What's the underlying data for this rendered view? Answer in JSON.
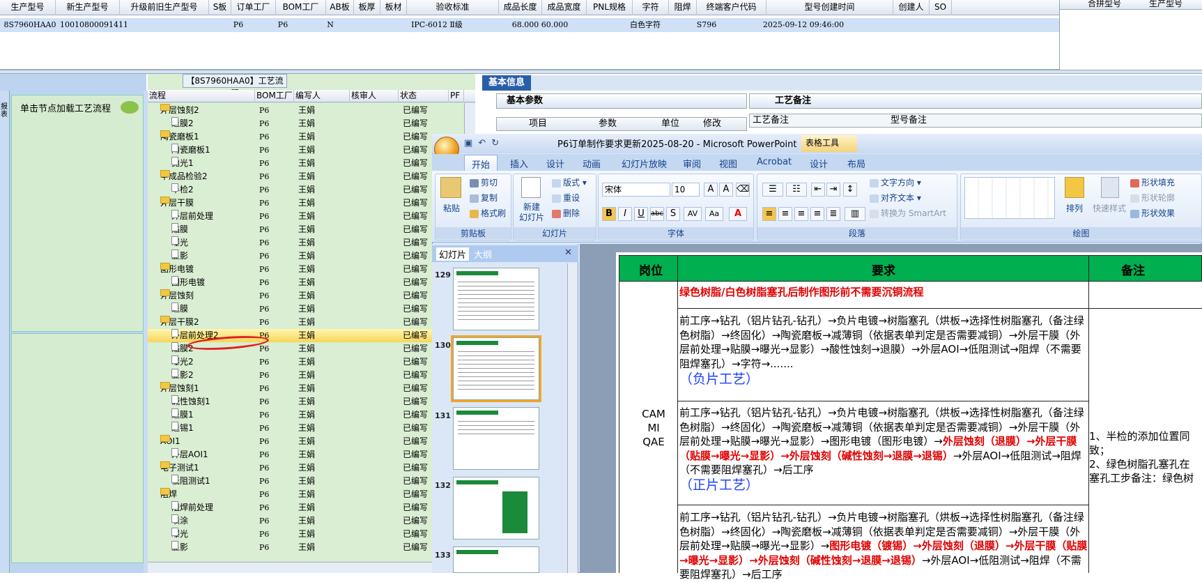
{
  "top_grid": {
    "columns": [
      "生产型号",
      "新生产型号",
      "升级前旧生产型号",
      "S板",
      "订单工厂",
      "BOM工厂",
      "AB板",
      "板厚",
      "板材",
      "验收标准",
      "成品长度",
      "成品宽度",
      "PNL规格",
      "字符",
      "阻焊",
      "终端客户代码",
      "型号创建时间",
      "创建人",
      "SO"
    ],
    "row": [
      "8S7960HAA0",
      "10010800091411",
      "",
      "",
      "P6",
      "P6",
      "N",
      "",
      "",
      "IPC-6012 Ⅱ级",
      "68.000",
      "60.000",
      "",
      "白色字符",
      "",
      "S796",
      "2025-09-12 09:46:00",
      "",
      ""
    ]
  },
  "right_panel": {
    "col1": "合拼型号",
    "col2": "生产型号"
  },
  "process_title": "【8S7960HAA0】工艺流程",
  "node_label": "单击节点加载工艺流程",
  "left_tab_text": "报表",
  "tree": {
    "headers": [
      "流程",
      "BOM工厂",
      "编写人",
      "核审人",
      "状态",
      "PF"
    ],
    "rows": [
      {
        "level": 1,
        "name": "外层蚀刻2",
        "bom": "P6",
        "editor": "王娟",
        "status": "已编写"
      },
      {
        "level": 2,
        "name": "退膜2",
        "bom": "P6",
        "editor": "王娟",
        "status": "已编写"
      },
      {
        "level": 1,
        "name": "陶瓷磨板1",
        "bom": "P6",
        "editor": "王娟",
        "status": "已编写"
      },
      {
        "level": 2,
        "name": "陶瓷磨板1",
        "bom": "P6",
        "editor": "王娟",
        "status": "已编写"
      },
      {
        "level": 2,
        "name": "抛光1",
        "bom": "P6",
        "editor": "王娟",
        "status": "已编写"
      },
      {
        "level": 1,
        "name": "半成品检验2",
        "bom": "P6",
        "editor": "王娟",
        "status": "已编写"
      },
      {
        "level": 2,
        "name": "半检2",
        "bom": "P6",
        "editor": "王娟",
        "status": "已编写"
      },
      {
        "level": 1,
        "name": "外层干膜",
        "bom": "P6",
        "editor": "王娟",
        "status": "已编写"
      },
      {
        "level": 2,
        "name": "外层前处理",
        "bom": "P6",
        "editor": "王娟",
        "status": "已编写"
      },
      {
        "level": 2,
        "name": "贴膜",
        "bom": "P6",
        "editor": "王娟",
        "status": "已编写"
      },
      {
        "level": 2,
        "name": "曝光",
        "bom": "P6",
        "editor": "王娟",
        "status": "已编写"
      },
      {
        "level": 2,
        "name": "显影",
        "bom": "P6",
        "editor": "王娟",
        "status": "已编写"
      },
      {
        "level": 1,
        "name": "图形电镀",
        "bom": "P6",
        "editor": "王娟",
        "status": "已编写"
      },
      {
        "level": 2,
        "name": "图形电镀",
        "bom": "P6",
        "editor": "王娟",
        "status": "已编写"
      },
      {
        "level": 1,
        "name": "外层蚀刻",
        "bom": "P6",
        "editor": "王娟",
        "status": "已编写"
      },
      {
        "level": 2,
        "name": "退膜",
        "bom": "P6",
        "editor": "王娟",
        "status": "已编写"
      },
      {
        "level": 1,
        "name": "外层干膜2",
        "bom": "P6",
        "editor": "王娟",
        "status": "已编写"
      },
      {
        "level": 2,
        "name": "外层前处理2",
        "bom": "P6",
        "editor": "王娟",
        "status": "已编写",
        "selected": true
      },
      {
        "level": 2,
        "name": "贴膜2",
        "bom": "P6",
        "editor": "王娟",
        "status": "已编写"
      },
      {
        "level": 2,
        "name": "曝光2",
        "bom": "P6",
        "editor": "王娟",
        "status": "已编写"
      },
      {
        "level": 2,
        "name": "显影2",
        "bom": "P6",
        "editor": "王娟",
        "status": "已编写"
      },
      {
        "level": 1,
        "name": "外层蚀刻1",
        "bom": "P6",
        "editor": "王娟",
        "status": "已编写"
      },
      {
        "level": 2,
        "name": "碱性蚀刻1",
        "bom": "P6",
        "editor": "王娟",
        "status": "已编写"
      },
      {
        "level": 2,
        "name": "退膜1",
        "bom": "P6",
        "editor": "王娟",
        "status": "已编写"
      },
      {
        "level": 2,
        "name": "退锡1",
        "bom": "P6",
        "editor": "王娟",
        "status": "已编写"
      },
      {
        "level": 1,
        "name": "AOI1",
        "bom": "P6",
        "editor": "王娟",
        "status": "已编写"
      },
      {
        "level": 2,
        "name": "外层AOI1",
        "bom": "P6",
        "editor": "王娟",
        "status": "已编写"
      },
      {
        "level": 1,
        "name": "电子测试1",
        "bom": "P6",
        "editor": "王娟",
        "status": "已编写"
      },
      {
        "level": 2,
        "name": "低阻测试1",
        "bom": "P6",
        "editor": "王娟",
        "status": "已编写"
      },
      {
        "level": 1,
        "name": "阻焊",
        "bom": "P6",
        "editor": "王娟",
        "status": "已编写"
      },
      {
        "level": 2,
        "name": "阻焊前处理",
        "bom": "P6",
        "editor": "王娟",
        "status": "已编写"
      },
      {
        "level": 2,
        "name": "喷涂",
        "bom": "P6",
        "editor": "王娟",
        "status": "已编写"
      },
      {
        "level": 2,
        "name": "曝光",
        "bom": "P6",
        "editor": "王娟",
        "status": "已编写"
      },
      {
        "level": 2,
        "name": "显影",
        "bom": "P6",
        "editor": "王娟",
        "status": "已编写"
      }
    ]
  },
  "basic_info": {
    "title": "基本信息",
    "params_tab": "基本参数",
    "params_headers": [
      "项目",
      "参数",
      "单位",
      "修改"
    ],
    "process_note_tab": "工艺备注",
    "note_headers": [
      "工艺备注",
      "型号备注"
    ]
  },
  "ppt": {
    "title": "P6订单制作要求更新2025-08-20 - Microsoft PowerPoint",
    "table_tools": "表格工具",
    "tabs": [
      "开始",
      "插入",
      "设计",
      "动画",
      "幻灯片放映",
      "审阅",
      "视图",
      "Acrobat",
      "设计",
      "布局"
    ],
    "clipboard": {
      "label": "剪贴板",
      "paste": "粘贴",
      "cut": "剪切",
      "copy": "复制",
      "format_painter": "格式刷"
    },
    "slides_group": {
      "label": "幻灯片",
      "new_slide": "新建\n幻灯片",
      "layout": "版式",
      "reset": "重设",
      "delete": "删除"
    },
    "font_group": {
      "label": "字体",
      "font": "宋体",
      "size": "10"
    },
    "para_group": {
      "label": "段落",
      "text_dir": "文字方向",
      "align_text": "对齐文本",
      "smartart": "转换为 SmartArt"
    },
    "draw_group": {
      "label": "绘图",
      "arrange": "排列",
      "quick_styles": "快速样式",
      "fill": "形状填充",
      "outline": "形状轮廓",
      "effects": "形状效果"
    },
    "panel_tabs": [
      "幻灯片",
      "大纲"
    ],
    "slide_numbers": [
      "129",
      "130",
      "131",
      "132",
      "133"
    ],
    "table": {
      "headers": [
        "岗位",
        "要求",
        "备注"
      ],
      "green_note": "绿色树脂/白色树脂塞孔后制作图形前不需要沉铜流程",
      "role": "CAM\nMI\nQAE",
      "block1": "前工序→钻孔（铝片钻孔-钻孔）→负片电镀→树脂塞孔（烘板→选择性树脂塞孔（备注绿色树脂）→终固化）→陶瓷磨板→减薄铜（依据表单判定是否需要减铜）→外层干膜（外层前处理→贴膜→曝光→显影）→酸性蚀刻→退膜）→外层AOI→低阻测试→阻焊（不需要阻焊塞孔）→字符→.......",
      "block1_tag": "（负片工艺）",
      "block2_a": "前工序→钻孔（铝片钻孔-钻孔）→负片电镀→树脂塞孔（烘板→选择性树脂塞孔（备注绿色树脂）→终固化）→陶瓷磨板→减薄铜（依据表单判定是否需要减铜）→外层干膜（外层前处理→贴膜→曝光→显影）→图形电镀（图形电镀）→",
      "block2_red": "外层蚀刻（退膜）→外层干膜（贴膜→曝光→显影）→外层蚀刻（碱性蚀刻→退膜→退锡）",
      "block2_b": "→外层AOI→低阻测试→阻焊（不需要阻焊塞孔）→后工序",
      "block2_tag": "（正片工艺）",
      "block3_a": "前工序→钻孔（铝片钻孔-钻孔）→负片电镀→树脂塞孔（烘板→选择性树脂塞孔（备注绿色树脂）→终固化）→陶瓷磨板→减薄铜（依据表单判定是否需要减铜）→外层干膜（外层前处理→贴膜→曝光→显影）→",
      "block3_red": "图形电镀（镀锡）→外层蚀刻（退膜）→外层干膜（贴膜→曝光→显影）→外层蚀刻（碱性蚀刻→退膜→退锡）",
      "block3_b": "→外层AOI→低阻测试→阻焊（不需要阻焊塞孔）→后工序",
      "note": "1、半检的添加位置同\n致；\n2、绿色树脂孔塞孔在\n塞孔工步备注：绿色树"
    }
  },
  "colors": {
    "accent": "#2a5ea8",
    "tree_bg": "#d9eed2",
    "header_green": "#00b050",
    "red_text": "#e00000"
  }
}
